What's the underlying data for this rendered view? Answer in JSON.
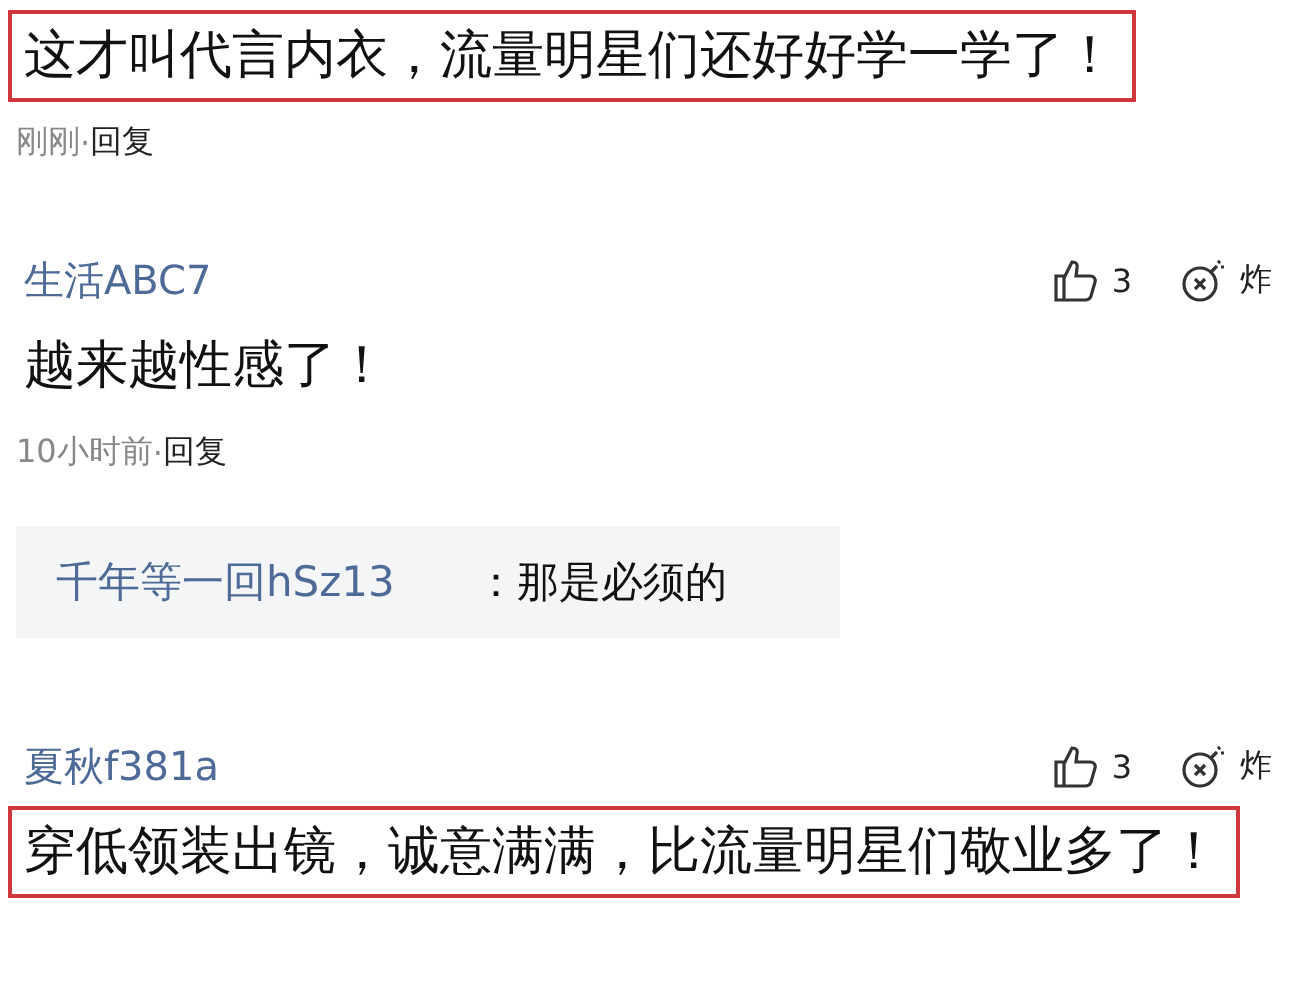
{
  "comments": [
    {
      "text": "这才叫代言内衣，流量明星们还好好学一学了！",
      "highlighted": true,
      "time": "刚刚",
      "separator": "·",
      "reply_label": "回复"
    },
    {
      "user": "生活ABC7",
      "likes": "3",
      "bomb_label": "炸",
      "text": "越来越性感了！",
      "highlighted": false,
      "time": "10小时前",
      "separator": "·",
      "reply_label": "回复",
      "replies": [
        {
          "user": "千年等一回hSz13",
          "text": "：那是必须的"
        }
      ]
    },
    {
      "user": "夏秋f381a",
      "likes": "3",
      "bomb_label": "炸",
      "text": "穿低领装出镜，诚意满满，比流量明星们敬业多了！",
      "highlighted": true
    }
  ]
}
